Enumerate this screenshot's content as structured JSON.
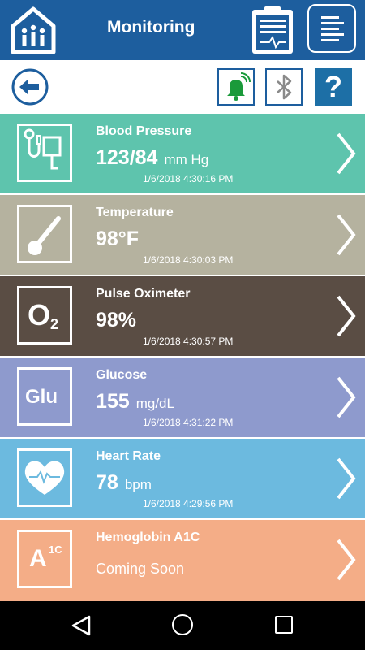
{
  "header": {
    "title": "Monitoring"
  },
  "toolbar": {
    "help_label": "?"
  },
  "colors": {
    "header_bg": "#1d5e9e",
    "accent": "#1d6fa6",
    "bell_green": "#1a9a3a"
  },
  "readings": [
    {
      "label": "Blood Pressure",
      "value": "123/84",
      "unit": "mm Hg",
      "timestamp": "1/6/2018 4:30:16 PM",
      "icon": "blood-pressure-cuff-icon",
      "color": "#5ec4ad"
    },
    {
      "label": "Temperature",
      "value": "98°F",
      "unit": "",
      "timestamp": "1/6/2018 4:30:03 PM",
      "icon": "thermometer-icon",
      "color": "#b5b29f"
    },
    {
      "label": "Pulse Oximeter",
      "value": "98%",
      "unit": "",
      "timestamp": "1/6/2018 4:30:57 PM",
      "icon": "oxygen-icon",
      "color": "#5a4d44"
    },
    {
      "label": "Glucose",
      "value": "155",
      "unit": "mg/dL",
      "timestamp": "1/6/2018 4:31:22 PM",
      "icon": "glucose-icon",
      "color": "#8e9acd"
    },
    {
      "label": "Heart Rate",
      "value": "78",
      "unit": "bpm",
      "timestamp": "1/6/2018 4:29:56 PM",
      "icon": "heart-icon",
      "color": "#6cbadf"
    },
    {
      "label": "Hemoglobin A1C",
      "status": "Coming Soon",
      "icon": "a1c-icon",
      "color": "#f4ad87"
    }
  ],
  "icon_text": {
    "o2_main": "O",
    "o2_sub": "2",
    "glu": "Glu",
    "a1c_main": "A",
    "a1c_sup": "1C"
  }
}
